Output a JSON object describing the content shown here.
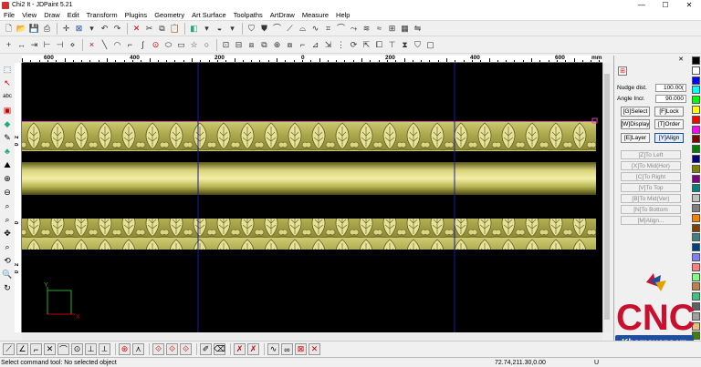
{
  "window": {
    "title": "Chi2 It - JDPaint 5.21",
    "minimize": "—",
    "maximize": "☐",
    "close": "✕"
  },
  "menu": [
    "File",
    "View",
    "Draw",
    "Edit",
    "Transform",
    "Plugins",
    "Geometry",
    "Art Surface",
    "Toolpaths",
    "ArtDraw",
    "Measure",
    "Help"
  ],
  "ruler": {
    "unit": "mm",
    "labels": [
      "600",
      "400",
      "200",
      "0",
      "200",
      "400",
      "600"
    ],
    "vlabels": [
      "0",
      "2",
      "0",
      "0",
      "2",
      "0",
      "0",
      "2"
    ]
  },
  "panel": {
    "nudge_label": "Nudge dist.",
    "nudge_value": "100.00(",
    "angle_label": "Angle Incr.",
    "angle_value": "90.000",
    "buttons": [
      "[G]Select",
      "[F]Lock",
      "[W]Display",
      "[T]Order",
      "[E]Layer",
      "[Y]Align"
    ],
    "align_buttons": [
      "[Z]To Left",
      "[X]To Mid(Hor)",
      "[C]To Right",
      "[V]To Top",
      "[B]To Mid(Ver)",
      "[N]To Bottom",
      "[M]Align..."
    ]
  },
  "status": {
    "message": "Select command tool: No selected object",
    "coords": "72.74,211.30,0.00",
    "mode": "U"
  },
  "logo": {
    "brand": "CNC",
    "site": "Khomaucnc.vn",
    "accent": "#c8102e",
    "blue": "#1f4e9c"
  },
  "palette": [
    "#000000",
    "#ffffff",
    "#0000ff",
    "#00ffff",
    "#00ff00",
    "#ffff00",
    "#ff0000",
    "#ff00ff",
    "#800000",
    "#008000",
    "#000080",
    "#808000",
    "#800080",
    "#008080",
    "#c0c0c0",
    "#808080",
    "#ff8000",
    "#804000",
    "#408080",
    "#004080",
    "#8080ff",
    "#ff8080",
    "#80ff80",
    "#c08040",
    "#40c080",
    "#606060",
    "#a0a0a0",
    "#e0c080",
    "#408000",
    "#800040"
  ],
  "colors": {
    "ornament_gold": "#bdb85a",
    "canvas_bg": "#000000",
    "guide_blue": "#1a1aa0"
  }
}
